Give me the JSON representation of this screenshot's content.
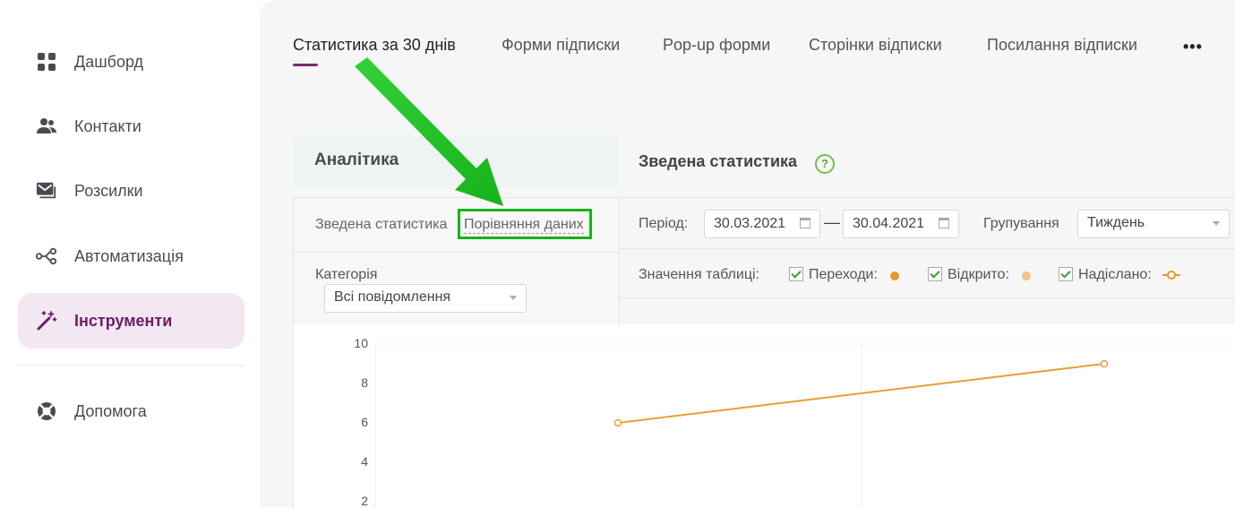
{
  "sidebar": {
    "items": [
      {
        "label": "Дашборд",
        "icon": "dashboard-grid-icon"
      },
      {
        "label": "Контакти",
        "icon": "contacts-people-icon"
      },
      {
        "label": "Розсилки",
        "icon": "mail-campaigns-icon"
      },
      {
        "label": "Автоматизація",
        "icon": "automation-nodes-icon"
      },
      {
        "label": "Інструменти",
        "icon": "magic-wand-icon",
        "active": true
      },
      {
        "label": "Допомога",
        "icon": "lifebuoy-help-icon"
      }
    ]
  },
  "tabs": [
    {
      "label": "Статистика за 30 днів",
      "active": true
    },
    {
      "label": "Форми підписки"
    },
    {
      "label": "Pop-up форми"
    },
    {
      "label": "Сторінки відписки"
    },
    {
      "label": "Посилання відписки"
    }
  ],
  "more_label": "•••",
  "analytics": {
    "title": "Аналітика",
    "summary_link": "Зведена статистика",
    "compare_link": "Порівняння даних",
    "category_label": "Категорія",
    "category_value": "Всі повідомлення"
  },
  "summary": {
    "title": "Зведена статистика",
    "help": "?",
    "period_label": "Період:",
    "date_from": "30.03.2021",
    "date_to": "30.04.2021",
    "dash": "—",
    "grouping_label": "Групування",
    "grouping_value": "Тиждень",
    "table_values_label": "Значення таблиці:",
    "metrics": [
      {
        "label": "Переходи:",
        "checked": true,
        "color": "#e8962e"
      },
      {
        "label": "Відкрито:",
        "checked": true,
        "color": "#f3c48a"
      },
      {
        "label": "Надіслано:",
        "checked": true,
        "color": "#e8962e"
      }
    ]
  },
  "colors": {
    "accent": "#7b2a73",
    "active_bg": "#f3e8f2",
    "highlight_box": "#16b31a",
    "line": "#e8a03a"
  },
  "chart_data": {
    "type": "line",
    "yticks": [
      "10",
      "8",
      "6",
      "4",
      "2"
    ],
    "ylim": [
      2,
      10
    ],
    "series": [
      {
        "name": "Надіслано",
        "points": [
          {
            "x": 1,
            "y": 6
          },
          {
            "x": 2,
            "y": 9
          }
        ]
      }
    ]
  }
}
